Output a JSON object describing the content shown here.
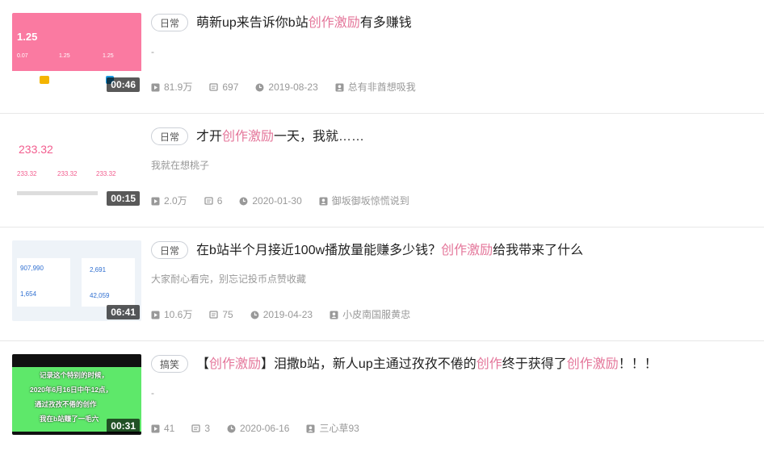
{
  "items": [
    {
      "tag": "日常",
      "title_pre": "萌新up来告诉你b站",
      "title_kw1": "创作激励",
      "title_mid": "有多赚钱",
      "title_kw2": "",
      "title_post": "",
      "title_kw3": "",
      "title_end": "",
      "desc": "-",
      "duration": "00:46",
      "plays": "81.9万",
      "danmaku": "697",
      "date": "2019-08-23",
      "uploader": "总有非酋想吸我",
      "thumb_text": {
        "big": "1.25",
        "a": "0.07",
        "b": "1.25",
        "c": "1.25"
      }
    },
    {
      "tag": "日常",
      "title_pre": "才开",
      "title_kw1": "创作激励",
      "title_mid": "一天，我就……",
      "title_kw2": "",
      "title_post": "",
      "title_kw3": "",
      "title_end": "",
      "desc": "我就在想桃子",
      "duration": "00:15",
      "plays": "2.0万",
      "danmaku": "6",
      "date": "2020-01-30",
      "uploader": "御坂御坂惊慌说到",
      "thumb_text": {
        "big": "233.32",
        "a": "233.32",
        "b": "233.32",
        "c": "233.32"
      }
    },
    {
      "tag": "日常",
      "title_pre": "在b站半个月接近100w播放量能赚多少钱？",
      "title_kw1": "创作激励",
      "title_mid": "给我带来了什么",
      "title_kw2": "",
      "title_post": "",
      "title_kw3": "",
      "title_end": "",
      "desc": "大家耐心看完，别忘记投币点赞收藏",
      "duration": "06:41",
      "plays": "10.6万",
      "danmaku": "75",
      "date": "2019-04-23",
      "uploader": "小皮南国服黄忠",
      "thumb_text": {
        "big": "907,990",
        "a": "2,691",
        "b": "1,654",
        "c": "42,059"
      }
    },
    {
      "tag": "搞笑",
      "title_pre": "【",
      "title_kw1": "创作激励",
      "title_mid": "】泪撒b站，新人up主通过孜孜不倦的",
      "title_kw2": "创作",
      "title_post": "终于获得了",
      "title_kw3": "创作激励",
      "title_end": "！！！",
      "desc": "-",
      "duration": "00:31",
      "plays": "41",
      "danmaku": "3",
      "date": "2020-06-16",
      "uploader": "三心草93",
      "thumb_text": {
        "l1": "记录这个特别的时候，",
        "l2": "2020年6月16日中午12点，",
        "l3": "通过孜孜不倦的创作",
        "l4": "我在b站赚了一毛六"
      }
    }
  ],
  "icons": {
    "play": "play-icon",
    "danmaku": "danmaku-icon",
    "date": "clock-icon",
    "uploader": "user-icon"
  },
  "colors": {
    "keyword": "#e4769a",
    "meta": "#999999",
    "title": "#222222"
  }
}
